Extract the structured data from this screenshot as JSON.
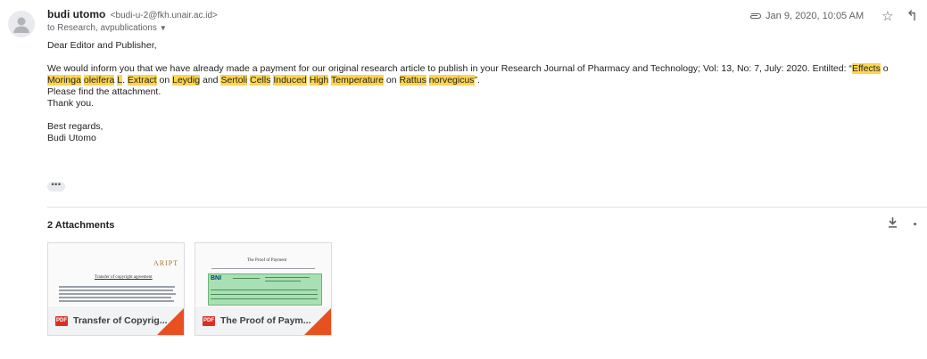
{
  "sender": {
    "name": "budi utomo",
    "email": "<budi-u-2@fkh.unair.ac.id>",
    "to": "to Research, avpublications"
  },
  "meta": {
    "date": "Jan 9, 2020, 10:05 AM",
    "icons": [
      "attachment-icon",
      "star-icon",
      "reply-icon"
    ]
  },
  "body": {
    "greeting": "Dear Editor and Publisher,",
    "para1_prefix": "We would inform you that we have already made a payment for our original research article to publish in your Research Journal of Pharmacy and Technology; Vol: 13, No: 7, July: 2020. Entilted: “",
    "p1_effects": "Effects",
    "p1_tail": " o",
    "line2_moringa": "Moringa",
    "line2_oleifera": "oleifera",
    "line2_L": "L",
    "line2_after_L": ". ",
    "line2_extract": "Extract",
    "line2_on1": " on ",
    "line2_leydig": "Leydig",
    "line2_and": " and ",
    "line2_sertoli": "Sertoli",
    "line2_cells": "Cells",
    "line2_induced": "Induced",
    "line2_high": "High",
    "line2_temperature": "Temperature",
    "line2_on2": " on ",
    "line2_rattus": "Rattus",
    "line2_norvegicus": "norvegicus",
    "line2_end": "”.",
    "line3": "Please find the attachment.",
    "line4": "Thank you.",
    "closing": "Best regards,",
    "signature": "Budi Utomo",
    "ellipsis": "•••"
  },
  "attachments": {
    "title": "2 Attachments",
    "items": [
      {
        "name": "Transfer of Copyrig...",
        "type": "PDF",
        "preview_logo": "ARIPT",
        "preview_heading": "Transfer of copyright agreement"
      },
      {
        "name": "The Proof of Paym...",
        "type": "PDF",
        "preview_heading": "The Proof of Payment",
        "preview_brand": "BNI"
      }
    ]
  }
}
